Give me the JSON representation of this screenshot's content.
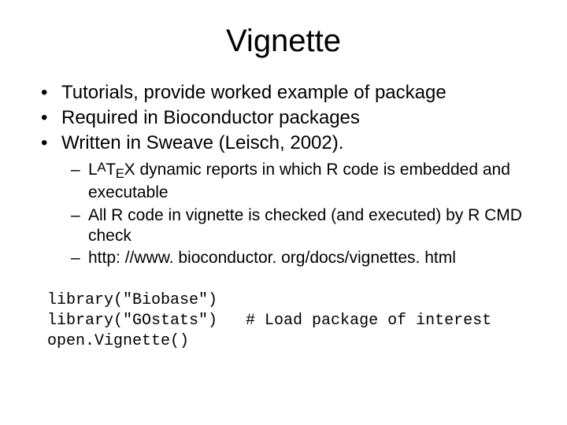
{
  "title": "Vignette",
  "bullets": [
    "Tutorials, provide worked example of package",
    "Required in Bioconductor packages",
    "Written in Sweave (Leisch, 2002)."
  ],
  "sub_prefix_latex": {
    "L": "L",
    "A": "A",
    "T": "T",
    "E": "E",
    "X": "X"
  },
  "sub_bullets": [
    " dynamic reports in which R code is embedded and executable",
    "All R code in vignette is checked (and executed) by R CMD check",
    "http: //www. bioconductor. org/docs/vignettes. html"
  ],
  "code": "library(\"Biobase\")\nlibrary(\"GOstats\")   # Load package of interest\nopen.Vignette()"
}
